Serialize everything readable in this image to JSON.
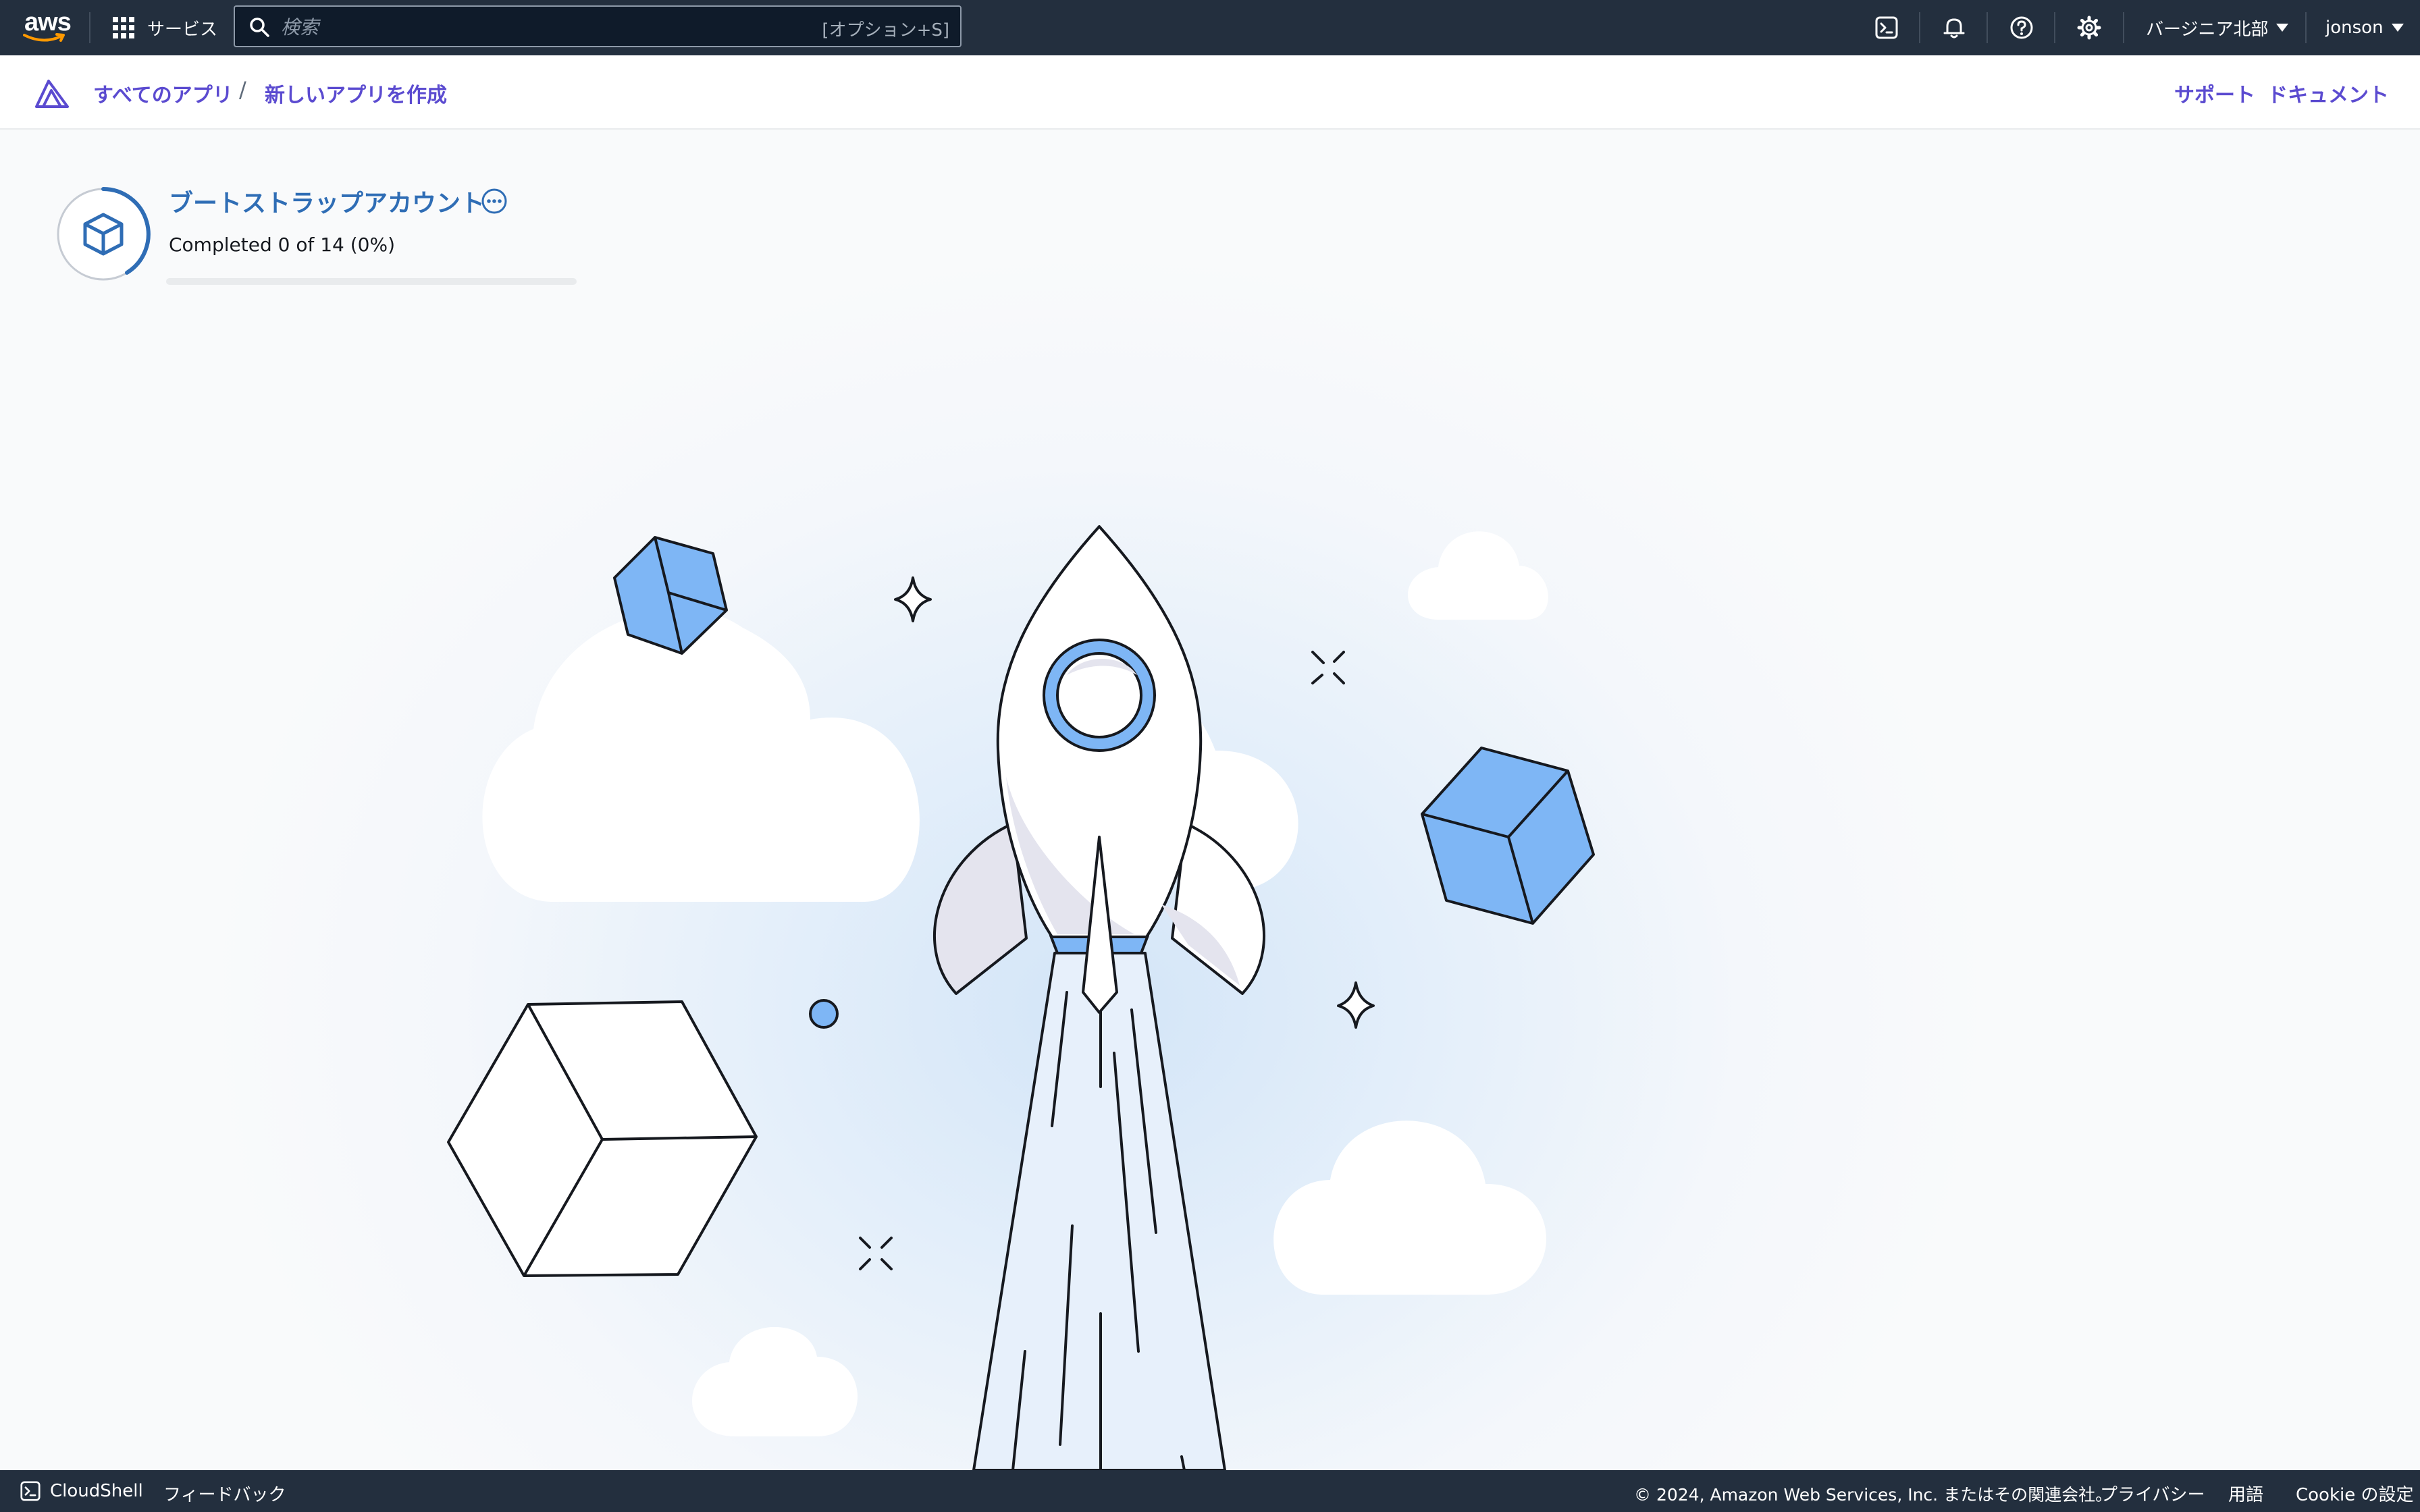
{
  "topnav": {
    "logo_text": "aws",
    "services_label": "サービス",
    "search": {
      "placeholder": "検索",
      "shortcut": "[オプション+S]"
    },
    "icons": [
      "cloudshell-icon",
      "bell-icon",
      "help-icon",
      "gear-icon"
    ],
    "region": "バージニア北部",
    "user": "jonson"
  },
  "appbar": {
    "breadcrumbs": [
      "すべてのアプリ",
      "新しいアプリを作成"
    ],
    "breadcrumb_separator": "/",
    "links": {
      "support": "サポート",
      "docs": "ドキュメント"
    }
  },
  "progress": {
    "title": "ブートストラップアカウント",
    "status_text": "Completed 0 of 14 (0%)",
    "completed": 0,
    "total": 14,
    "percent": 0
  },
  "footer": {
    "cloudshell": "CloudShell",
    "feedback": "フィードバック",
    "copyright": "© 2024, Amazon Web Services, Inc. またはその関連会社。",
    "links": [
      "プライバシー",
      "用語",
      "Cookie の設定"
    ]
  },
  "colors": {
    "nav_bg": "#232f3e",
    "link_purple": "#5b4bd0",
    "title_blue": "#2f6db5",
    "accent_blue": "#7eb6f5"
  }
}
